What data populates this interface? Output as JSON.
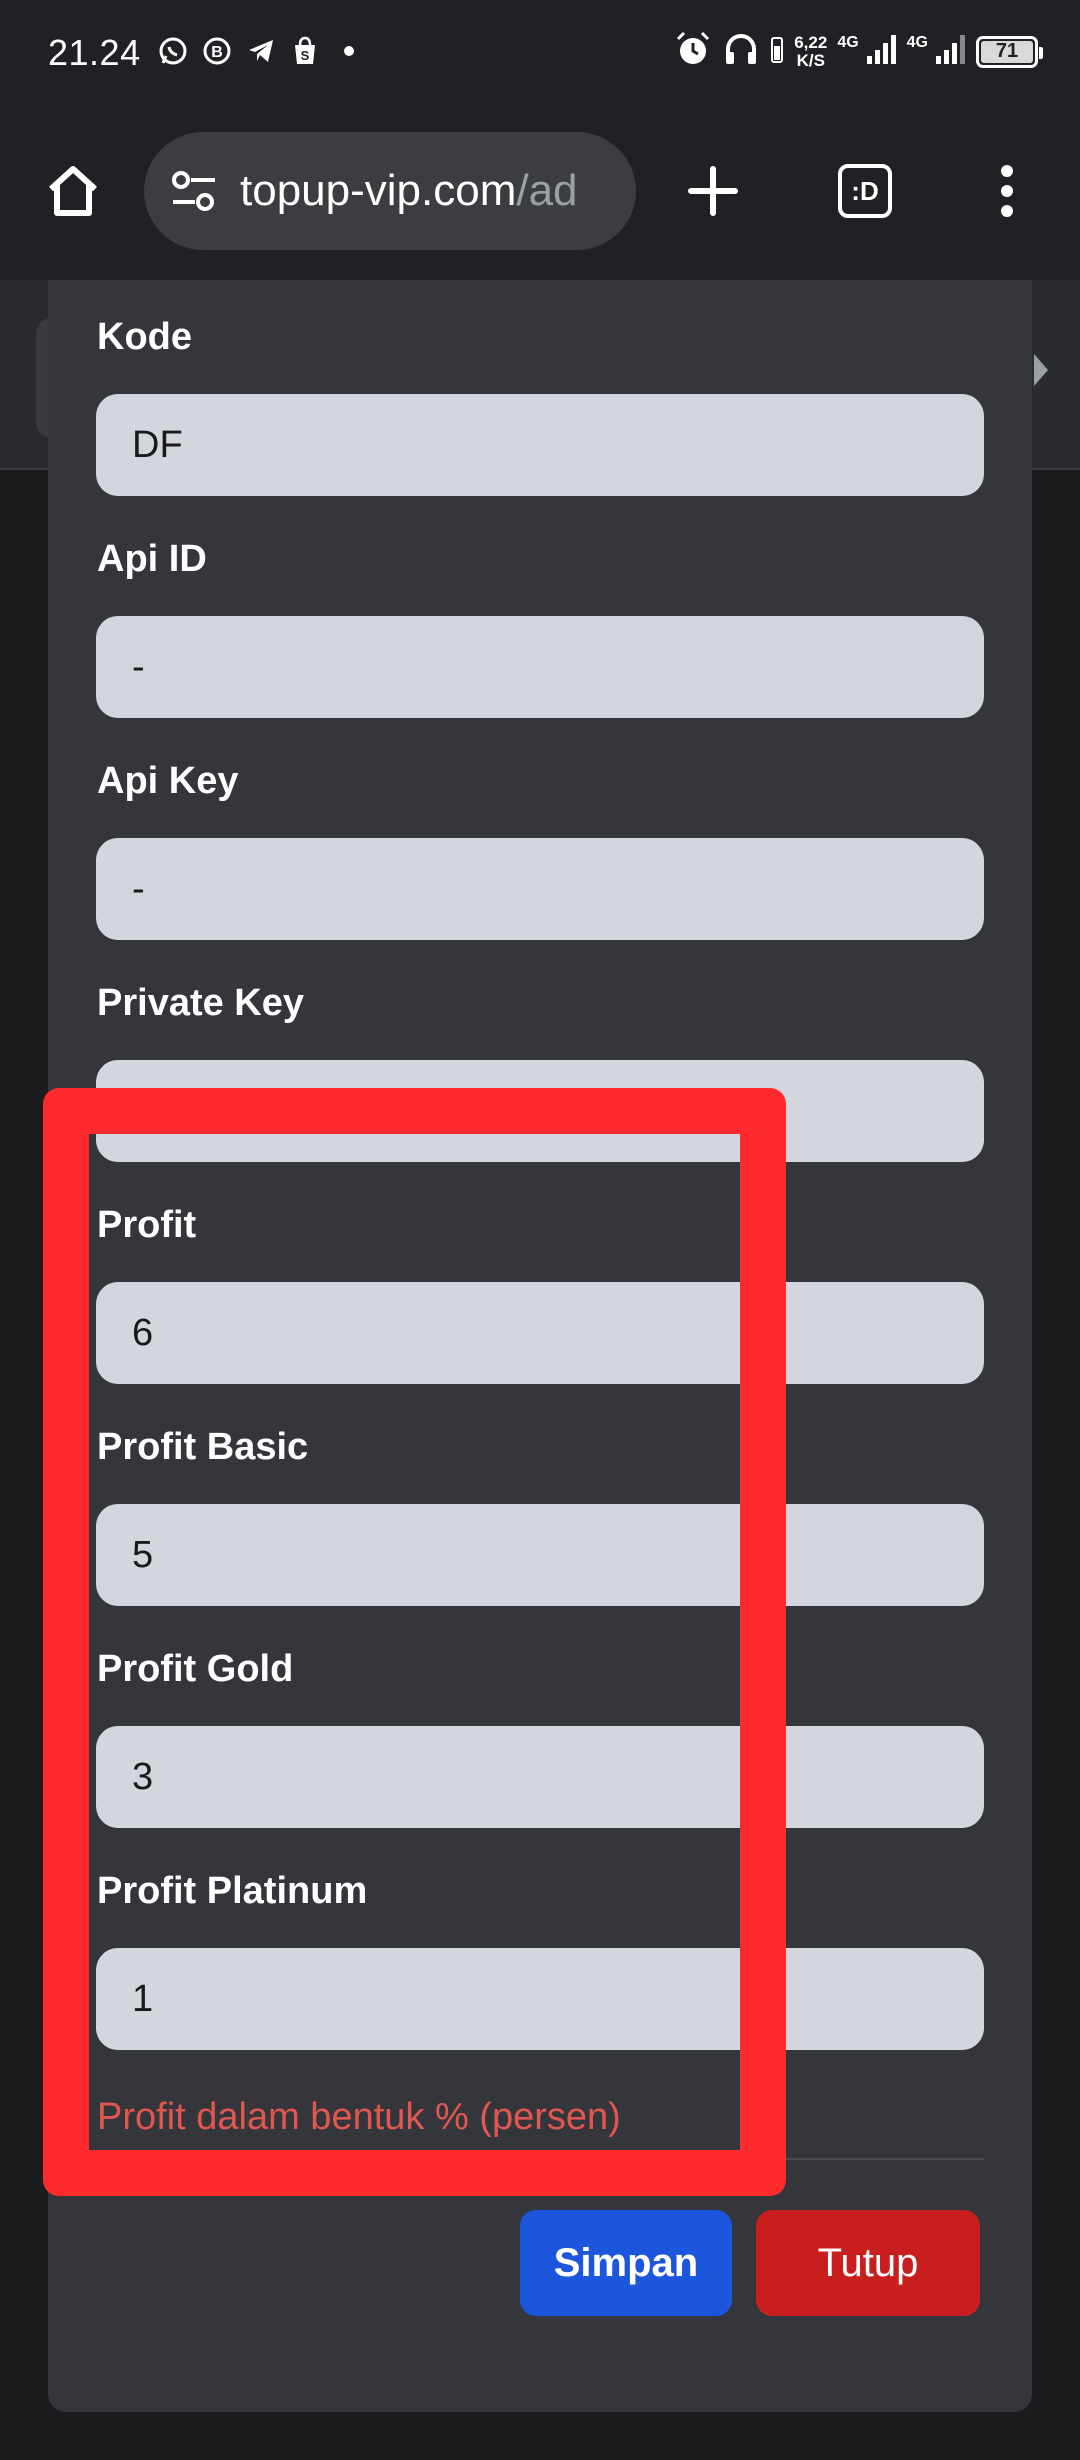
{
  "status_bar": {
    "time": "21.24",
    "net_speed_value": "6,22",
    "net_speed_unit": "K/S",
    "signal1_label": "4G",
    "signal2_label": "4G",
    "battery": "71"
  },
  "browser": {
    "url_host": "topup-vip.com",
    "url_path": "/ad",
    "tabs_label": ":D"
  },
  "form": {
    "fields": [
      {
        "label": "Kode",
        "value": "DF"
      },
      {
        "label": "Api ID",
        "value": "-"
      },
      {
        "label": "Api Key",
        "value": "-"
      },
      {
        "label": "Private Key",
        "value": ""
      },
      {
        "label": "Profit",
        "value": "6"
      },
      {
        "label": "Profit Basic",
        "value": "5"
      },
      {
        "label": "Profit Gold",
        "value": "3"
      },
      {
        "label": "Profit Platinum",
        "value": "1"
      }
    ],
    "help_text": "Profit dalam bentuk % (persen)",
    "save_label": "Simpan",
    "close_label": "Tutup"
  },
  "colors": {
    "save_button": "#1b56dd",
    "close_button": "#c81e1e",
    "help_text": "#e0574f",
    "annotation": "#ff2a2e"
  }
}
